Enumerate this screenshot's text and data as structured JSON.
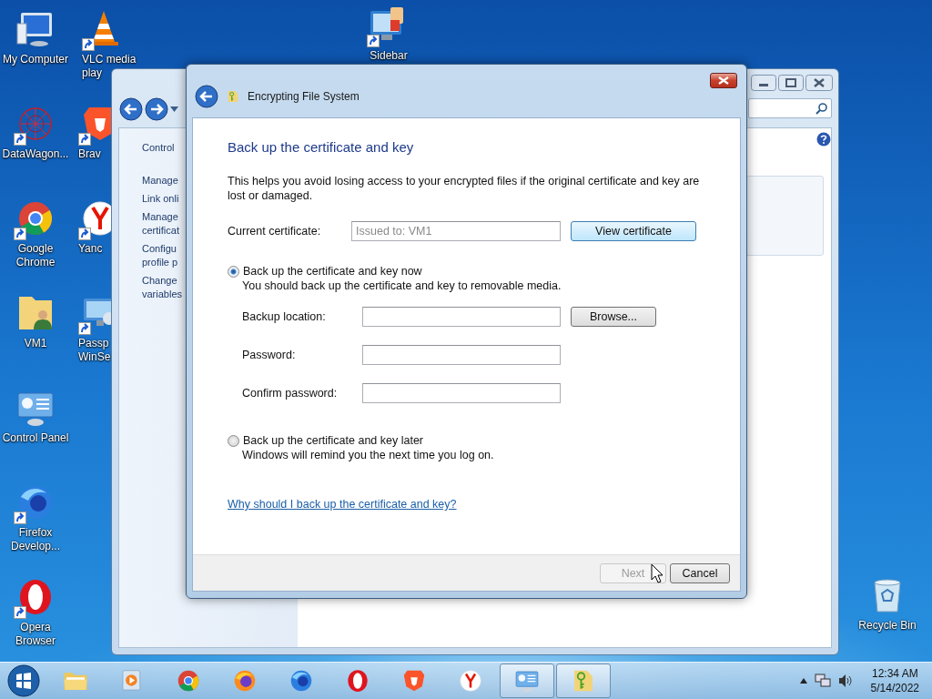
{
  "desktop": {
    "first_column": [
      {
        "kind": "computer",
        "label": "My Computer",
        "shortcut": false
      },
      {
        "kind": "sphere",
        "label": "DataWagon...",
        "shortcut": true
      },
      {
        "kind": "ring",
        "label": "Google Chrome",
        "shortcut": true
      },
      {
        "kind": "userfolder",
        "label": "VM1",
        "shortcut": false
      },
      {
        "kind": "panel",
        "label": "Control Panel",
        "shortcut": false
      },
      {
        "kind": "bluefox",
        "label": "Firefox Develop...",
        "shortcut": true
      },
      {
        "kind": "oring",
        "label": "Opera Browser",
        "shortcut": true
      }
    ],
    "second_column": [
      {
        "kind": "cone",
        "label": "VLC media play",
        "shortcut": true
      },
      {
        "kind": "lion",
        "label": "Brav",
        "shortcut": true
      },
      {
        "kind": "yletter",
        "label": "Yanc",
        "shortcut": true
      },
      {
        "kind": "monitor",
        "label": "Passp WinSe",
        "shortcut": true
      }
    ],
    "top_icon": {
      "kind": "gadgets",
      "label": "Sidebar",
      "shortcut": true
    },
    "corner_icon": {
      "kind": "bin",
      "label": "Recycle Bin",
      "shortcut": false
    }
  },
  "background_window": {
    "nav_items": [
      "Control",
      "Manage",
      "Link onli",
      "Manage certificat",
      "Configu profile p",
      "Change variables"
    ]
  },
  "dialog": {
    "title": "Encrypting File System",
    "heading": "Back up the certificate and key",
    "intro": "This helps you avoid losing access to your encrypted files if the original certificate and key are lost or damaged.",
    "current_certificate": {
      "label": "Current certificate:",
      "value": "Issued to: VM1",
      "disabled": true,
      "button": "View certificate"
    },
    "options": [
      {
        "label": "Back up the certificate and key now",
        "description": "You should back up the certificate and key to removable media.",
        "selected": true,
        "fields": [
          {
            "label": "Backup location:",
            "button": "Browse..."
          },
          {
            "label": "Password:"
          },
          {
            "label": "Confirm password:"
          }
        ]
      },
      {
        "label": "Back up the certificate and key later",
        "description": "Windows will remind you the next time you log on.",
        "selected": false
      }
    ],
    "help_link": "Why should I back up the certificate and key?",
    "buttons": [
      {
        "label": "Next",
        "disabled": true
      },
      {
        "label": "Cancel",
        "disabled": false
      }
    ]
  },
  "taskbar": {
    "items": [
      {
        "kind": "folder",
        "open": false
      },
      {
        "kind": "player",
        "open": false
      },
      {
        "kind": "ring",
        "open": false
      },
      {
        "kind": "orangefox",
        "open": false
      },
      {
        "kind": "bluefox",
        "open": false
      },
      {
        "kind": "oring",
        "open": false
      },
      {
        "kind": "lion",
        "open": false
      },
      {
        "kind": "yletter",
        "open": false
      },
      {
        "kind": "panel",
        "open": true
      },
      {
        "kind": "keyfolder",
        "open": true
      }
    ],
    "time": "12:34 AM",
    "date": "5/14/2022"
  }
}
